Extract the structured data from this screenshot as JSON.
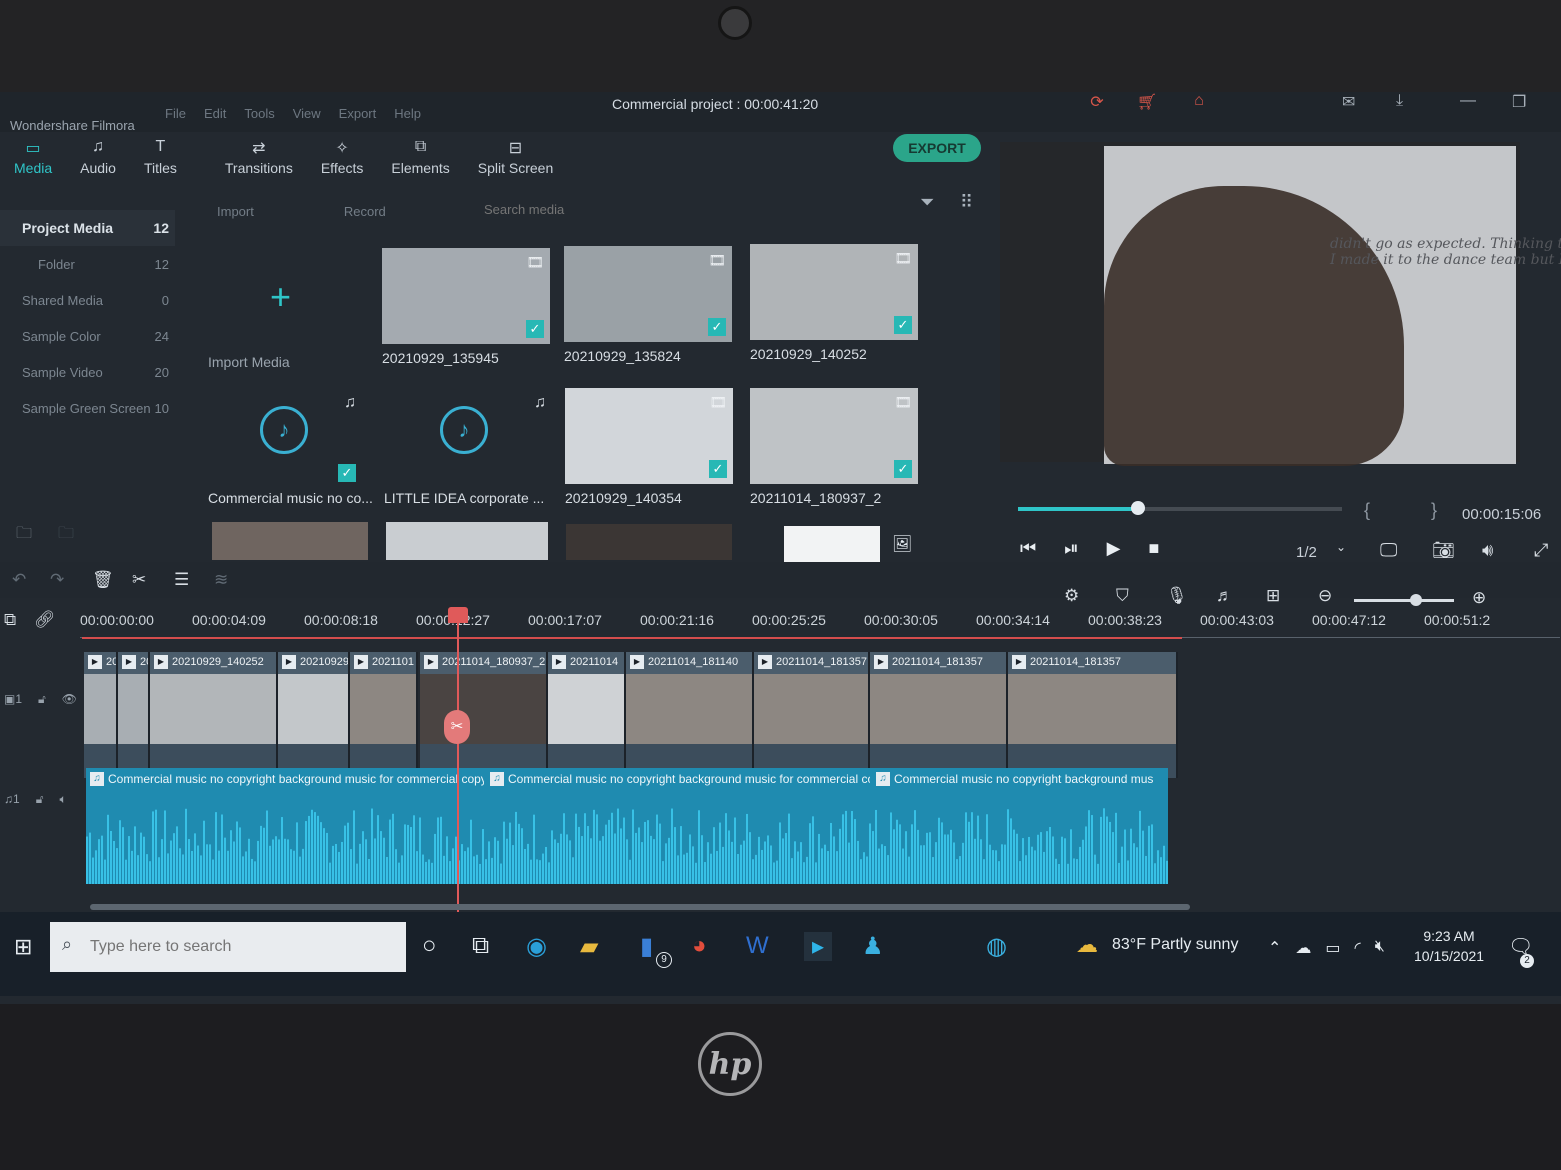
{
  "app": {
    "name": "Wondershare Filmora",
    "project_title": "Commercial project : 00:00:41:20",
    "menu": [
      "File",
      "Edit",
      "Tools",
      "View",
      "Export",
      "Help"
    ]
  },
  "toolbar": {
    "tabs": [
      {
        "label": "Media",
        "icon": "folder-icon"
      },
      {
        "label": "Audio",
        "icon": "audio-icon"
      },
      {
        "label": "Titles",
        "icon": "titles-icon"
      },
      {
        "label": "Transitions",
        "icon": "transitions-icon"
      },
      {
        "label": "Effects",
        "icon": "effects-icon"
      },
      {
        "label": "Elements",
        "icon": "elements-icon"
      },
      {
        "label": "Split Screen",
        "icon": "split-screen-icon"
      }
    ],
    "export_label": "EXPORT"
  },
  "sidebar": {
    "items": [
      {
        "label": "Project Media",
        "count": "12"
      },
      {
        "label": "Folder",
        "count": "12"
      },
      {
        "label": "Shared Media",
        "count": "0"
      },
      {
        "label": "Sample Color",
        "count": "24"
      },
      {
        "label": "Sample Video",
        "count": "20"
      },
      {
        "label": "Sample Green Screen",
        "count": "10"
      }
    ]
  },
  "media": {
    "import_label": "Import",
    "record_label": "Record",
    "search_placeholder": "Search media",
    "import_media_label": "Import Media",
    "tiles": [
      {
        "label": "20210929_135945",
        "kind": "video"
      },
      {
        "label": "20210929_135824",
        "kind": "video"
      },
      {
        "label": "20210929_140252",
        "kind": "video"
      },
      {
        "label": "Commercial music no co...",
        "kind": "audio"
      },
      {
        "label": "LITTLE IDEA corporate ...",
        "kind": "audio"
      },
      {
        "label": "20210929_140354",
        "kind": "video"
      },
      {
        "label": "20211014_180937_2",
        "kind": "video"
      }
    ]
  },
  "preview": {
    "handwriting": "didn't go as expected. Thinking that I made it to the dance team but I",
    "timecode": "00:00:15:06",
    "progress": 0.37,
    "brackets": "{ }",
    "ratio": "1/2"
  },
  "timeline": {
    "ruler": [
      "00:00:00:00",
      "00:00:04:09",
      "00:00:08:18",
      "00:00:12:27",
      "00:00:17:07",
      "00:00:21:16",
      "00:00:25:25",
      "00:00:30:05",
      "00:00:34:14",
      "00:00:38:23",
      "00:00:43:03",
      "00:00:47:12",
      "00:00:51:2"
    ],
    "video_clips": [
      {
        "label": "20"
      },
      {
        "label": "20"
      },
      {
        "label": "20210929_140252"
      },
      {
        "label": "20210929"
      },
      {
        "label": "2021101"
      },
      {
        "label": "20211014_180937_2"
      },
      {
        "label": "20211014"
      },
      {
        "label": "20211014_181140"
      },
      {
        "label": "20211014_181357"
      },
      {
        "label": "20211014_181357"
      },
      {
        "label": "20211014_181357"
      }
    ],
    "audio_clips": [
      {
        "label": "Commercial music no copyright background music for commercial copyright fr"
      },
      {
        "label": "Commercial music no copyright background music for commercial cop"
      },
      {
        "label": "Commercial music no copyright background mus"
      }
    ],
    "zoom_level": 0.56
  },
  "taskbar": {
    "search_placeholder": "Type here to search",
    "weather": "83°F  Partly sunny",
    "time": "9:23 AM",
    "date": "10/15/2021",
    "notification_count": "2",
    "badge_count": "9"
  },
  "colors": {
    "accent": "#2fc5c8",
    "export": "#2ba58a",
    "playhead": "#e05a5a",
    "audio_track": "#1f8bb0"
  }
}
